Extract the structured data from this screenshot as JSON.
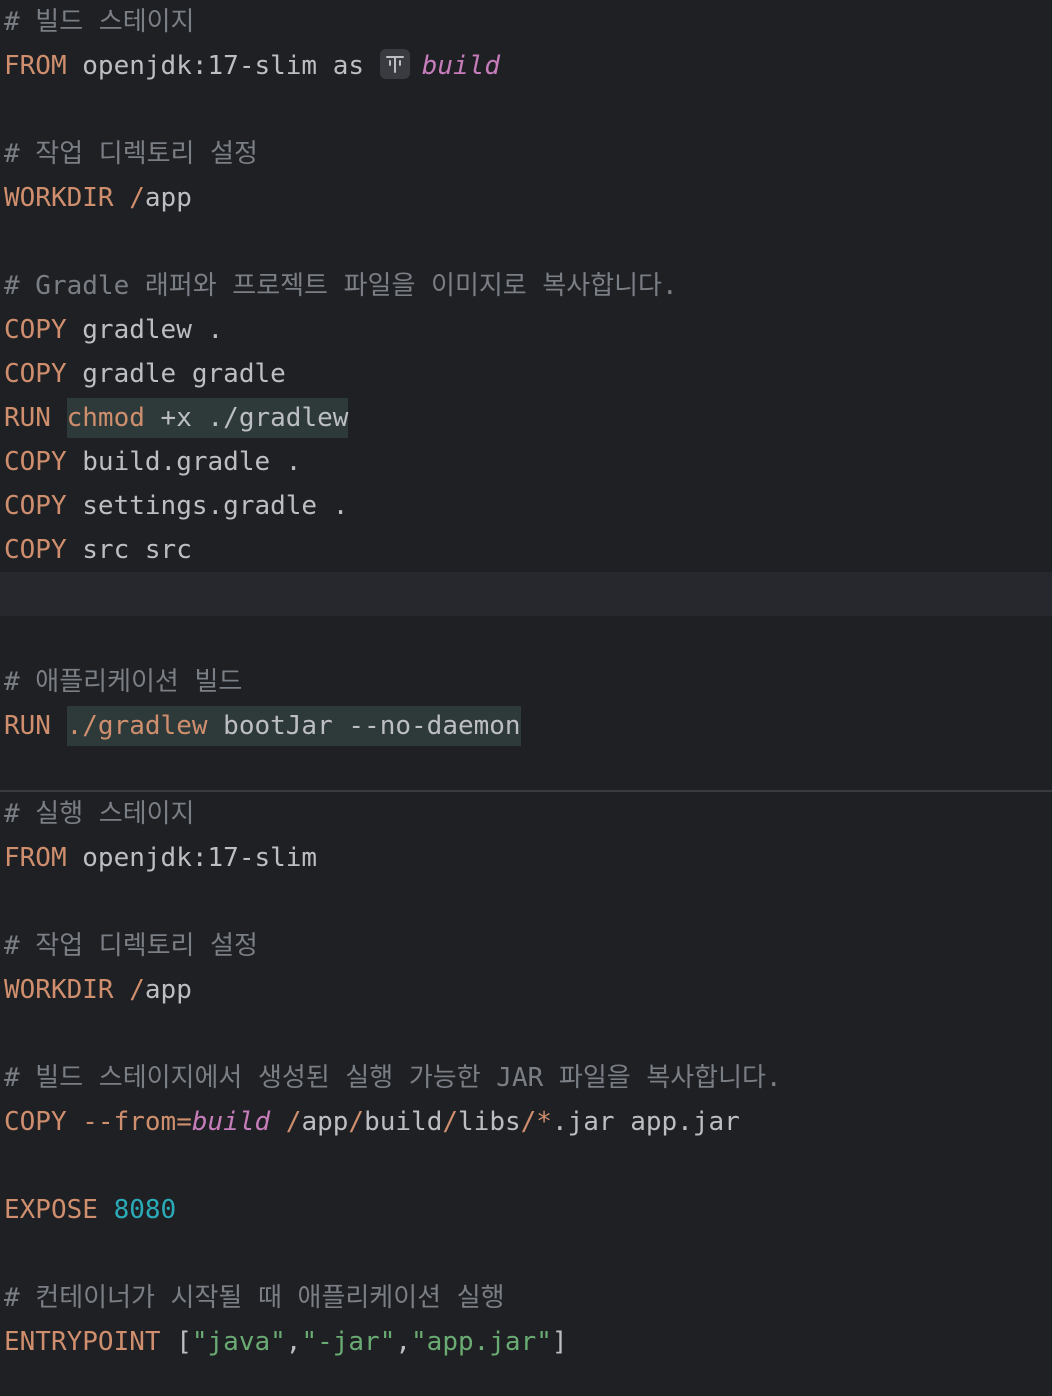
{
  "editor": {
    "lines": {
      "l1": {
        "text": "# 빌드 스테이지"
      },
      "l2": {
        "kw": "FROM",
        "image": "openjdk:17-slim",
        "as": "as",
        "stage_icon": "stage-icon",
        "stage": "build"
      },
      "l3": {
        "text": "# 작업 디렉토리 설정"
      },
      "l4": {
        "kw": "WORKDIR",
        "slash": "/",
        "path": "app"
      },
      "l5": {
        "text": "# Gradle 래퍼와 프로젝트 파일을 이미지로 복사합니다."
      },
      "l6": {
        "kw": "COPY",
        "args": "gradlew ."
      },
      "l7": {
        "kw": "COPY",
        "args": "gradle gradle"
      },
      "l8": {
        "kw": "RUN",
        "cmd": "chmod",
        "args": " +x ./gradlew"
      },
      "l9": {
        "kw": "COPY",
        "args": "build.gradle ."
      },
      "l10": {
        "kw": "COPY",
        "args": "settings.gradle ."
      },
      "l11": {
        "kw": "COPY",
        "args": "src src"
      },
      "l12": {
        "text": "# 애플리케이션 빌드"
      },
      "l13": {
        "kw": "RUN",
        "cmd": "./gradlew",
        "args": " bootJar --no-daemon"
      },
      "l14": {
        "text": "# 실행 스테이지"
      },
      "l15": {
        "kw": "FROM",
        "image": "openjdk:17-slim"
      },
      "l16": {
        "text": "# 작업 디렉토리 설정"
      },
      "l17": {
        "kw": "WORKDIR",
        "slash": "/",
        "path": "app"
      },
      "l18": {
        "text": "# 빌드 스테이지에서 생성된 실행 가능한 JAR 파일을 복사합니다."
      },
      "l19": {
        "kw": "COPY",
        "flag": "--from=",
        "stage": "build",
        "s1": "/",
        "p1": "app",
        "s2": "/",
        "p2": "build",
        "s3": "/",
        "p3": "libs",
        "s4": "/",
        "star": "*",
        "rest": ".jar app.jar"
      },
      "l20": {
        "kw": "EXPOSE",
        "port": "8080"
      },
      "l21": {
        "text": "# 컨테이너가 시작될 때 애플리케이션 실행"
      },
      "l22": {
        "kw": "ENTRYPOINT",
        "open": "[",
        "a1": "\"java\"",
        "c1": ",",
        "a2": "\"-jar\"",
        "c2": ",",
        "a3": "\"app.jar\"",
        "close": "]"
      }
    }
  },
  "colors": {
    "background": "#1f2023",
    "keyword": "#cf8e6d",
    "comment": "#7a7e85",
    "text": "#bcbec4",
    "stage_name": "#c77dbb",
    "number": "#2aacb8",
    "string": "#6aab73",
    "shell_highlight": "#2e3a3a"
  }
}
